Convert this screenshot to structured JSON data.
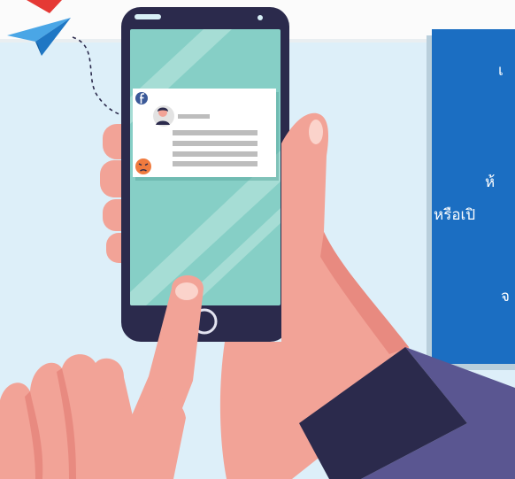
{
  "panel": {
    "lines": [
      "เ",
      "ห้",
      "หรือเปิ",
      "จ"
    ]
  },
  "icons": {
    "social_badge": "facebook-icon",
    "reaction": "angry-face-icon",
    "avatar": "user-avatar-icon",
    "plane": "paper-plane-icon",
    "home": "home-button-icon"
  },
  "colors": {
    "background": "#ddeff9",
    "panel": "#1b6ec2",
    "phone_body": "#2b2a4c",
    "phone_screen": "#86cfc6",
    "skin": "#f2a397",
    "sleeve": "#2b2a4c",
    "arm": "#5a5691",
    "accent_red": "#e53935",
    "plane_blue": "#3b9ce0",
    "reaction_orange": "#f07b3f",
    "facebook_blue": "#3b5998"
  }
}
